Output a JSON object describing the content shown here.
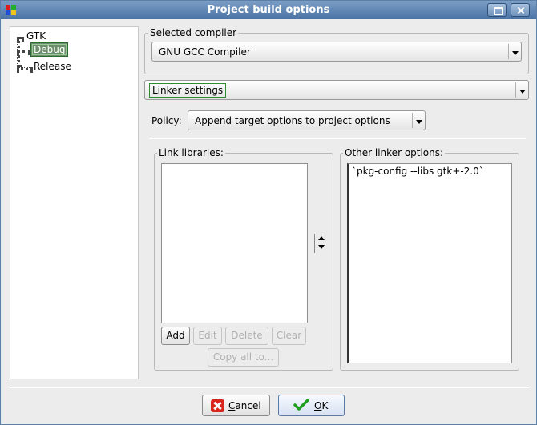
{
  "window": {
    "title": "Project build options"
  },
  "tree": {
    "root": "GTK",
    "children": [
      "Debug",
      "Release"
    ],
    "selected": "Debug"
  },
  "compiler": {
    "group_label": "Selected compiler",
    "value": "GNU GCC Compiler"
  },
  "settings_tab": {
    "value": "Linker settings"
  },
  "policy": {
    "label": "Policy:",
    "value": "Append target options to project options"
  },
  "link_libraries": {
    "group_label": "Link libraries:",
    "items": [],
    "buttons": {
      "add": "Add",
      "edit": "Edit",
      "delete": "Delete",
      "clear": "Clear",
      "copy_all": "Copy all to..."
    }
  },
  "other_linker": {
    "group_label": "Other linker options:",
    "text": "`pkg-config --libs gtk+-2.0`"
  },
  "dialog_buttons": {
    "cancel_mnemonic": "C",
    "cancel_rest": "ancel",
    "ok_mnemonic": "O",
    "ok_rest": "K"
  },
  "colors": {
    "titlebar": "#4a73a5",
    "selection": "#6b8f6b",
    "focus_outline": "#2e8b2e"
  }
}
